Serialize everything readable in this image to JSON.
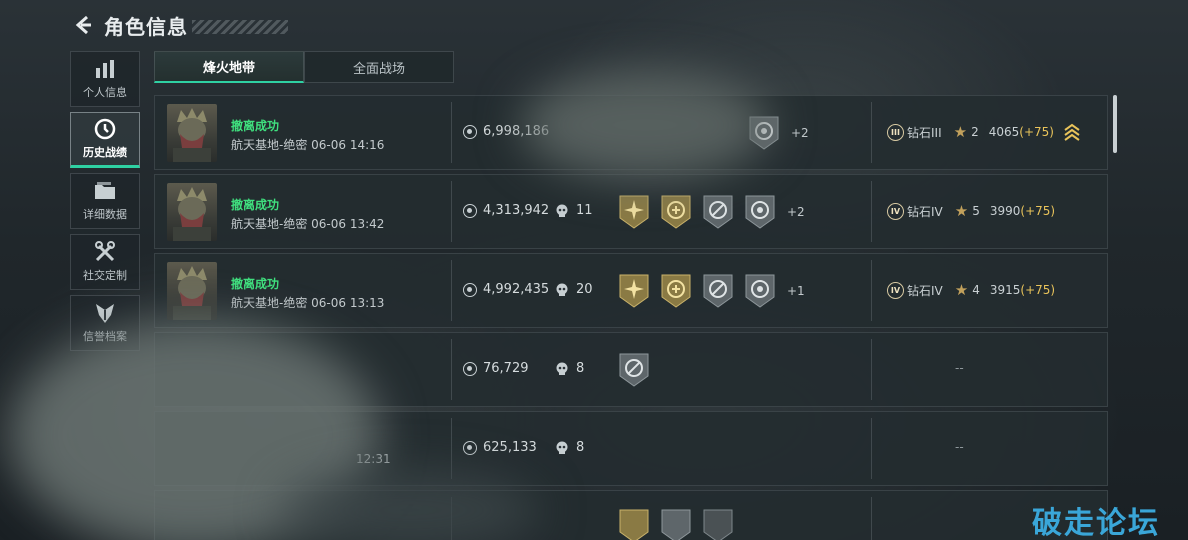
{
  "header": {
    "title": "角色信息"
  },
  "nav": [
    {
      "label": "个人信息",
      "icon": "bar-chart-icon",
      "active": false
    },
    {
      "label": "历史战绩",
      "icon": "clock-icon",
      "active": true
    },
    {
      "label": "详细数据",
      "icon": "folder-icon",
      "active": false
    },
    {
      "label": "社交定制",
      "icon": "tools-icon",
      "active": false
    },
    {
      "label": "信誉档案",
      "icon": "emblem-icon",
      "active": false
    }
  ],
  "tabs": [
    {
      "label": "烽火地带",
      "active": true
    },
    {
      "label": "全面战场",
      "active": false
    }
  ],
  "rows": [
    {
      "status": "撤离成功",
      "map": "航天基地-绝密 06-06 14:16",
      "value": "6,998,186",
      "kills": "",
      "extra": "+2",
      "rank": {
        "tier": "钻石III",
        "numeral": "III",
        "stars": "2",
        "score": "4065",
        "delta": "(+75)"
      }
    },
    {
      "status": "撤离成功",
      "map": "航天基地-绝密 06-06 13:42",
      "value": "4,313,942",
      "kills": "11",
      "extra": "+2",
      "rank": {
        "tier": "钻石IV",
        "numeral": "IV",
        "stars": "5",
        "score": "3990",
        "delta": "(+75)"
      }
    },
    {
      "status": "撤离成功",
      "map": "航天基地-绝密 06-06 13:13",
      "value": "4,992,435",
      "kills": "20",
      "extra": "+1",
      "rank": {
        "tier": "钻石IV",
        "numeral": "IV",
        "stars": "4",
        "score": "3915",
        "delta": "(+75)"
      }
    },
    {
      "value": "76,729",
      "kills": "8",
      "rank_placeholder": "--"
    },
    {
      "time_tail": "12:31",
      "value": "625,133",
      "kills": "8",
      "rank_placeholder": "--"
    }
  ],
  "watermark": "破走论坛",
  "colors": {
    "accent": "#2fd1a3",
    "success": "#3fe07e",
    "gold": "#e8c35a"
  }
}
